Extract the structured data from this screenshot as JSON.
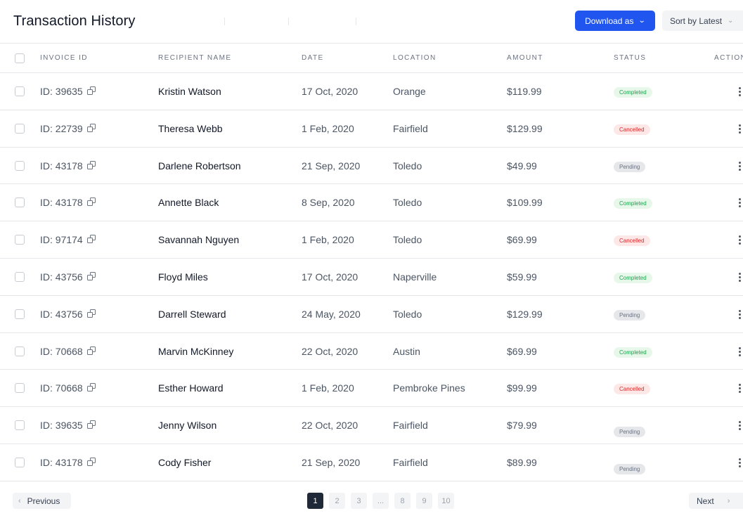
{
  "header": {
    "title": "Transaction History",
    "download_label": "Download as",
    "sort_label": "Sort by Latest"
  },
  "columns": [
    "INVOICE ID",
    "RECIPIENT NAME",
    "DATE",
    "LOCATION",
    "AMOUNT",
    "STATUS",
    "ACTION"
  ],
  "rows": [
    {
      "id": "ID: 39635",
      "name": "Kristin Watson",
      "date": "17 Oct, 2020",
      "location": "Orange",
      "amount": "$119.99",
      "status": "Completed"
    },
    {
      "id": "ID: 22739",
      "name": "Theresa Webb",
      "date": "1 Feb, 2020",
      "location": "Fairfield",
      "amount": "$129.99",
      "status": "Cancelled"
    },
    {
      "id": "ID: 43178",
      "name": "Darlene Robertson",
      "date": "21 Sep, 2020",
      "location": "Toledo",
      "amount": "$49.99",
      "status": "Pending"
    },
    {
      "id": "ID: 43178",
      "name": "Annette Black",
      "date": "8 Sep, 2020",
      "location": "Toledo",
      "amount": "$109.99",
      "status": "Completed"
    },
    {
      "id": "ID: 97174",
      "name": "Savannah Nguyen",
      "date": "1 Feb, 2020",
      "location": "Toledo",
      "amount": "$69.99",
      "status": "Cancelled"
    },
    {
      "id": "ID: 43756",
      "name": "Floyd Miles",
      "date": "17 Oct, 2020",
      "location": "Naperville",
      "amount": "$59.99",
      "status": "Completed"
    },
    {
      "id": "ID: 43756",
      "name": "Darrell Steward",
      "date": "24 May, 2020",
      "location": "Toledo",
      "amount": "$129.99",
      "status": "Pending"
    },
    {
      "id": "ID: 70668",
      "name": "Marvin McKinney",
      "date": "22 Oct, 2020",
      "location": "Austin",
      "amount": "$69.99",
      "status": "Completed"
    },
    {
      "id": "ID: 70668",
      "name": "Esther Howard",
      "date": "1 Feb, 2020",
      "location": "Pembroke Pines",
      "amount": "$99.99",
      "status": "Cancelled"
    },
    {
      "id": "ID: 39635",
      "name": "Jenny Wilson",
      "date": "22 Oct, 2020",
      "location": "Fairfield",
      "amount": "$79.99",
      "status": "Pending"
    },
    {
      "id": "ID: 43178",
      "name": "Cody Fisher",
      "date": "21 Sep, 2020",
      "location": "Fairfield",
      "amount": "$89.99",
      "status": "Pending"
    }
  ],
  "pagination": {
    "prev_label": "Previous",
    "next_label": "Next",
    "pages": [
      "1",
      "2",
      "3",
      "...",
      "8",
      "9",
      "10"
    ],
    "current": "1"
  },
  "colors": {
    "accent": "#2155f0",
    "completed": "#16a34a",
    "cancelled": "#dc2626",
    "pending": "#6b7280"
  },
  "icons": {
    "download_chevron": "chevron-down-icon",
    "sort_chevron": "chevron-down-icon",
    "copy": "copy-icon",
    "action": "more-vertical-icon",
    "prev": "chevron-left-icon",
    "next": "chevron-right-icon"
  }
}
